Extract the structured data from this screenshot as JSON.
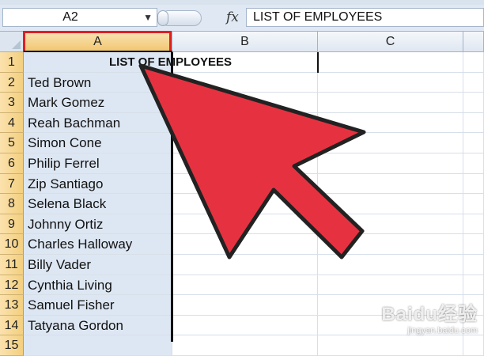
{
  "formula_bar": {
    "name_box": "A2",
    "fx_label": "fx",
    "formula": "LIST OF EMPLOYEES"
  },
  "columns": [
    "A",
    "B",
    "C"
  ],
  "rows": [
    {
      "num": "1",
      "a": "LIST OF EMPLOYEES"
    },
    {
      "num": "2",
      "a": "Ted Brown"
    },
    {
      "num": "3",
      "a": "Mark Gomez"
    },
    {
      "num": "4",
      "a": "Reah Bachman"
    },
    {
      "num": "5",
      "a": "Simon Cone"
    },
    {
      "num": "6",
      "a": "Philip Ferrel"
    },
    {
      "num": "7",
      "a": "Zip Santiago"
    },
    {
      "num": "8",
      "a": "Selena Black"
    },
    {
      "num": "9",
      "a": "Johnny Ortiz"
    },
    {
      "num": "10",
      "a": "Charles Halloway"
    },
    {
      "num": "11",
      "a": "Billy Vader"
    },
    {
      "num": "12",
      "a": "Cynthia Living"
    },
    {
      "num": "13",
      "a": "Samuel Fisher"
    },
    {
      "num": "14",
      "a": "Tatyana Gordon"
    },
    {
      "num": "15",
      "a": ""
    }
  ],
  "watermark": {
    "logo": "Baidu经验",
    "url": "jingyan.baidu.com"
  },
  "colors": {
    "highlight_box": "#e11f1f",
    "arrow_fill": "#e63240",
    "selected_row_header": "#f3cf7e",
    "selected_column_fill": "#dde7f3"
  }
}
